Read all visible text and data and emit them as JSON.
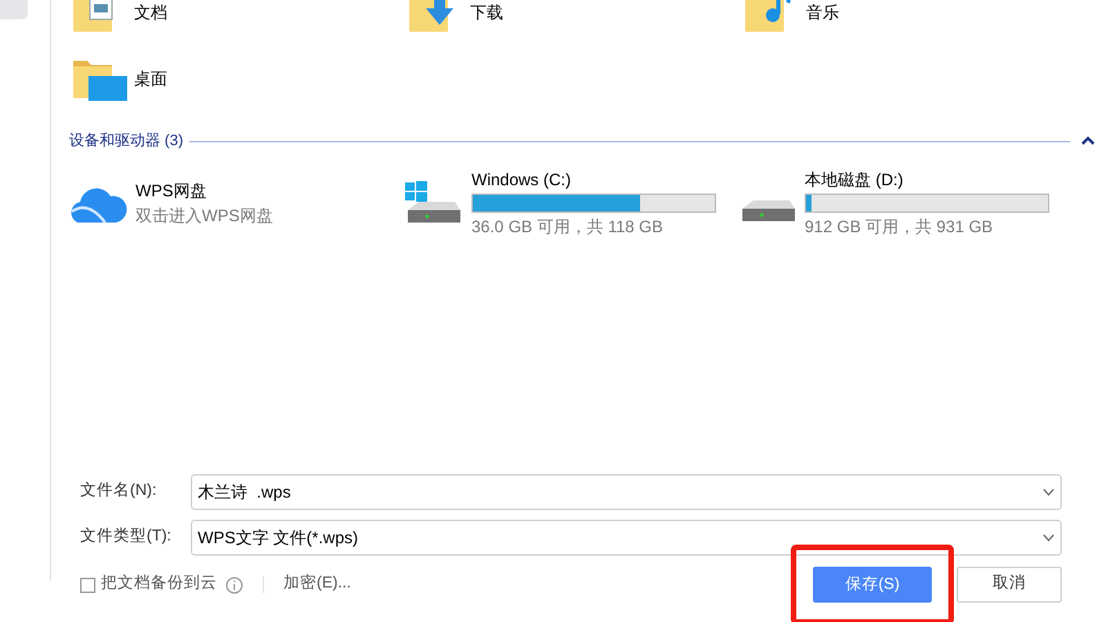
{
  "sidebar": {
    "items": [
      {
        "selected": true
      }
    ]
  },
  "folders": [
    {
      "label": "文档",
      "kind": "documents"
    },
    {
      "label": "下载",
      "kind": "downloads"
    },
    {
      "label": "音乐",
      "kind": "music"
    },
    {
      "label": "桌面",
      "kind": "desktop"
    }
  ],
  "devices_section": {
    "title": "设备和驱动器 (3)",
    "expanded": true
  },
  "devices": [
    {
      "kind": "cloud",
      "name": "WPS网盘",
      "subtitle": "双击进入WPS网盘"
    },
    {
      "kind": "system_drive",
      "name": "Windows (C:)",
      "level": 0.69,
      "subtitle": "36.0 GB 可用，共 118 GB"
    },
    {
      "kind": "drive",
      "name": "本地磁盘 (D:)",
      "level": 0.02,
      "subtitle": "912 GB 可用，共 931 GB"
    }
  ],
  "form": {
    "filename_label": "文件名(N):",
    "filename_value": "木兰诗  .wps",
    "filetype_label": "文件类型(T):",
    "filetype_value": "WPS文字 文件(*.wps)",
    "backup": {
      "label": "把文档备份到云",
      "checked": false
    },
    "encrypt_link": "加密(E)...",
    "save_button": "保存(S)",
    "cancel_button": "取消",
    "save_highlighted": true
  }
}
